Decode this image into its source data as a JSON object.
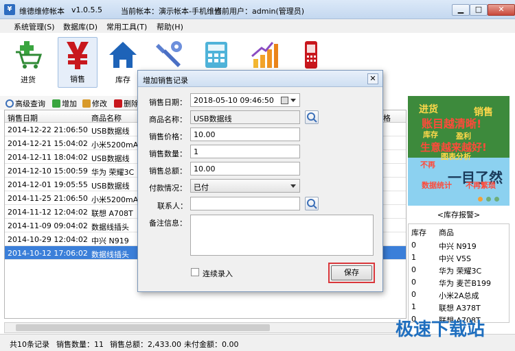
{
  "window": {
    "app_icon": "¥",
    "title": "维德维修帐本",
    "version": "v1.0.5.5",
    "account": "当前帐本：演示帐本-手机维修",
    "user": "当前用户：admin(管理员)"
  },
  "menu": [
    "系统管理(S)",
    "数据库(D)",
    "常用工具(T)",
    "帮助(H)"
  ],
  "toolbar": [
    {
      "label": "进货",
      "icon": "cart-icon"
    },
    {
      "label": "销售",
      "icon": "yen-icon"
    },
    {
      "label": "库存",
      "icon": "house-icon"
    },
    {
      "label": "",
      "icon": "wrench-icon"
    },
    {
      "label": "",
      "icon": "calculator-icon"
    },
    {
      "label": "",
      "icon": "growth-chart-icon"
    },
    {
      "label": "",
      "icon": "mobile-phone-icon"
    }
  ],
  "subtoolbar": [
    "高级查询",
    "增加",
    "修改",
    "删除"
  ],
  "grid": {
    "headers": [
      "销售日期",
      "商品名称"
    ],
    "right_header_fragments": [
      "格",
      "情况"
    ],
    "rows": [
      [
        "2014-12-22 21:06:50",
        "USB数据线"
      ],
      [
        "2014-12-21 15:04:02",
        "小米5200mAh移"
      ],
      [
        "2014-12-11 18:04:02",
        "USB数据线"
      ],
      [
        "2014-12-10 15:00:59",
        "华为 荣耀3C"
      ],
      [
        "2014-12-01 19:05:55",
        "USB数据线"
      ],
      [
        "2014-11-25 21:06:50",
        "小米5200mAh移"
      ],
      [
        "2014-11-12 12:04:02",
        "联想 A708T"
      ],
      [
        "2014-11-09 09:04:02",
        "数据线插头"
      ],
      [
        "2014-10-29 12:04:02",
        "中兴 N919"
      ],
      [
        "2014-10-12 17:06:02",
        "数据线插头"
      ]
    ],
    "selected_index": 9
  },
  "status": {
    "records": "共10条记录",
    "qty": "销售数量：11",
    "total": "销售总额：2,433.00",
    "unpaid": "未付金额：0.00"
  },
  "banner": {
    "line1": "进货",
    "line2": "销售",
    "line3": "账目越清晰!",
    "line4": "库存",
    "line5": "盈利",
    "line6": "生意越来越好!",
    "line7": "图表分析",
    "line8": "不再",
    "line9": "一目了然",
    "line10": "数据统计",
    "line11": "不再繁琐"
  },
  "stock": {
    "title": "<库存报警>",
    "headers": [
      "库存",
      "商品"
    ],
    "rows": [
      [
        "0",
        "中兴 N919"
      ],
      [
        "1",
        "中兴 V5S"
      ],
      [
        "0",
        "华为 荣耀3C"
      ],
      [
        "0",
        "华为 麦芒B199"
      ],
      [
        "0",
        "小米2A总成"
      ],
      [
        "1",
        "联想 A378T"
      ],
      [
        "0",
        "联想 A708T"
      ]
    ]
  },
  "watermark": "极速下载站",
  "dialog": {
    "title": "增加销售记录",
    "close": "✕",
    "fields": {
      "date_label": "销售日期：",
      "date_value": "2018-05-10 09:46:50",
      "name_label": "商品名称：",
      "name_value": "USB数据线",
      "price_label": "销售价格：",
      "price_value": "10.00",
      "qty_label": "销售数量：",
      "qty_value": "1",
      "total_label": "销售总额：",
      "total_value": "10.00",
      "pay_label": "付款情况：",
      "pay_value": "已付",
      "contact_label": "联系人：",
      "contact_value": "",
      "note_label": "备注信息：",
      "note_value": ""
    },
    "continuous": "连续录入",
    "save": "保存"
  }
}
